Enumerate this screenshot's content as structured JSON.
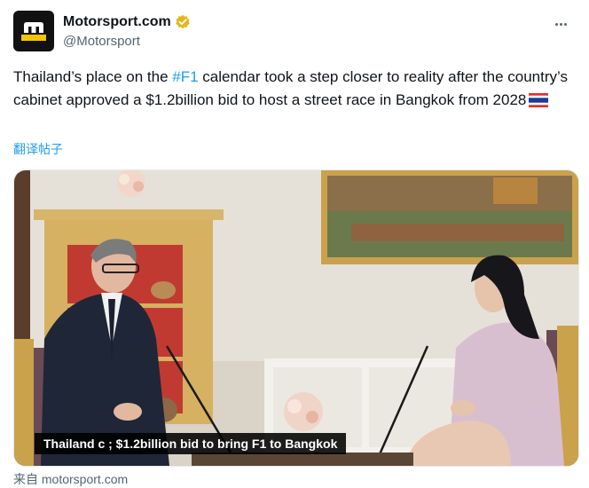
{
  "account": {
    "display_name": "Motorsport.com",
    "handle": "@Motorsport",
    "verified_icon": "verified-badge-gold",
    "logo_letter": "m"
  },
  "tweet": {
    "text_before_hashtag": "Thailand’s place on the ",
    "hashtag": "#F1",
    "text_after_hashtag": " calendar took a step closer to reality after the country’s cabinet approved a $1.2billion bid to host a street race in Bangkok from 2028",
    "flag_icon": "thailand-flag",
    "translate_label": "翻译帖子"
  },
  "card": {
    "caption": "Thailand c     ; $1.2billion bid to bring F1 to Bangkok",
    "source_label": "来自 motorsport.com"
  },
  "colors": {
    "link": "#1d9bf0",
    "logo_yellow": "#f5c400",
    "verified_gold": "#e2b719"
  }
}
